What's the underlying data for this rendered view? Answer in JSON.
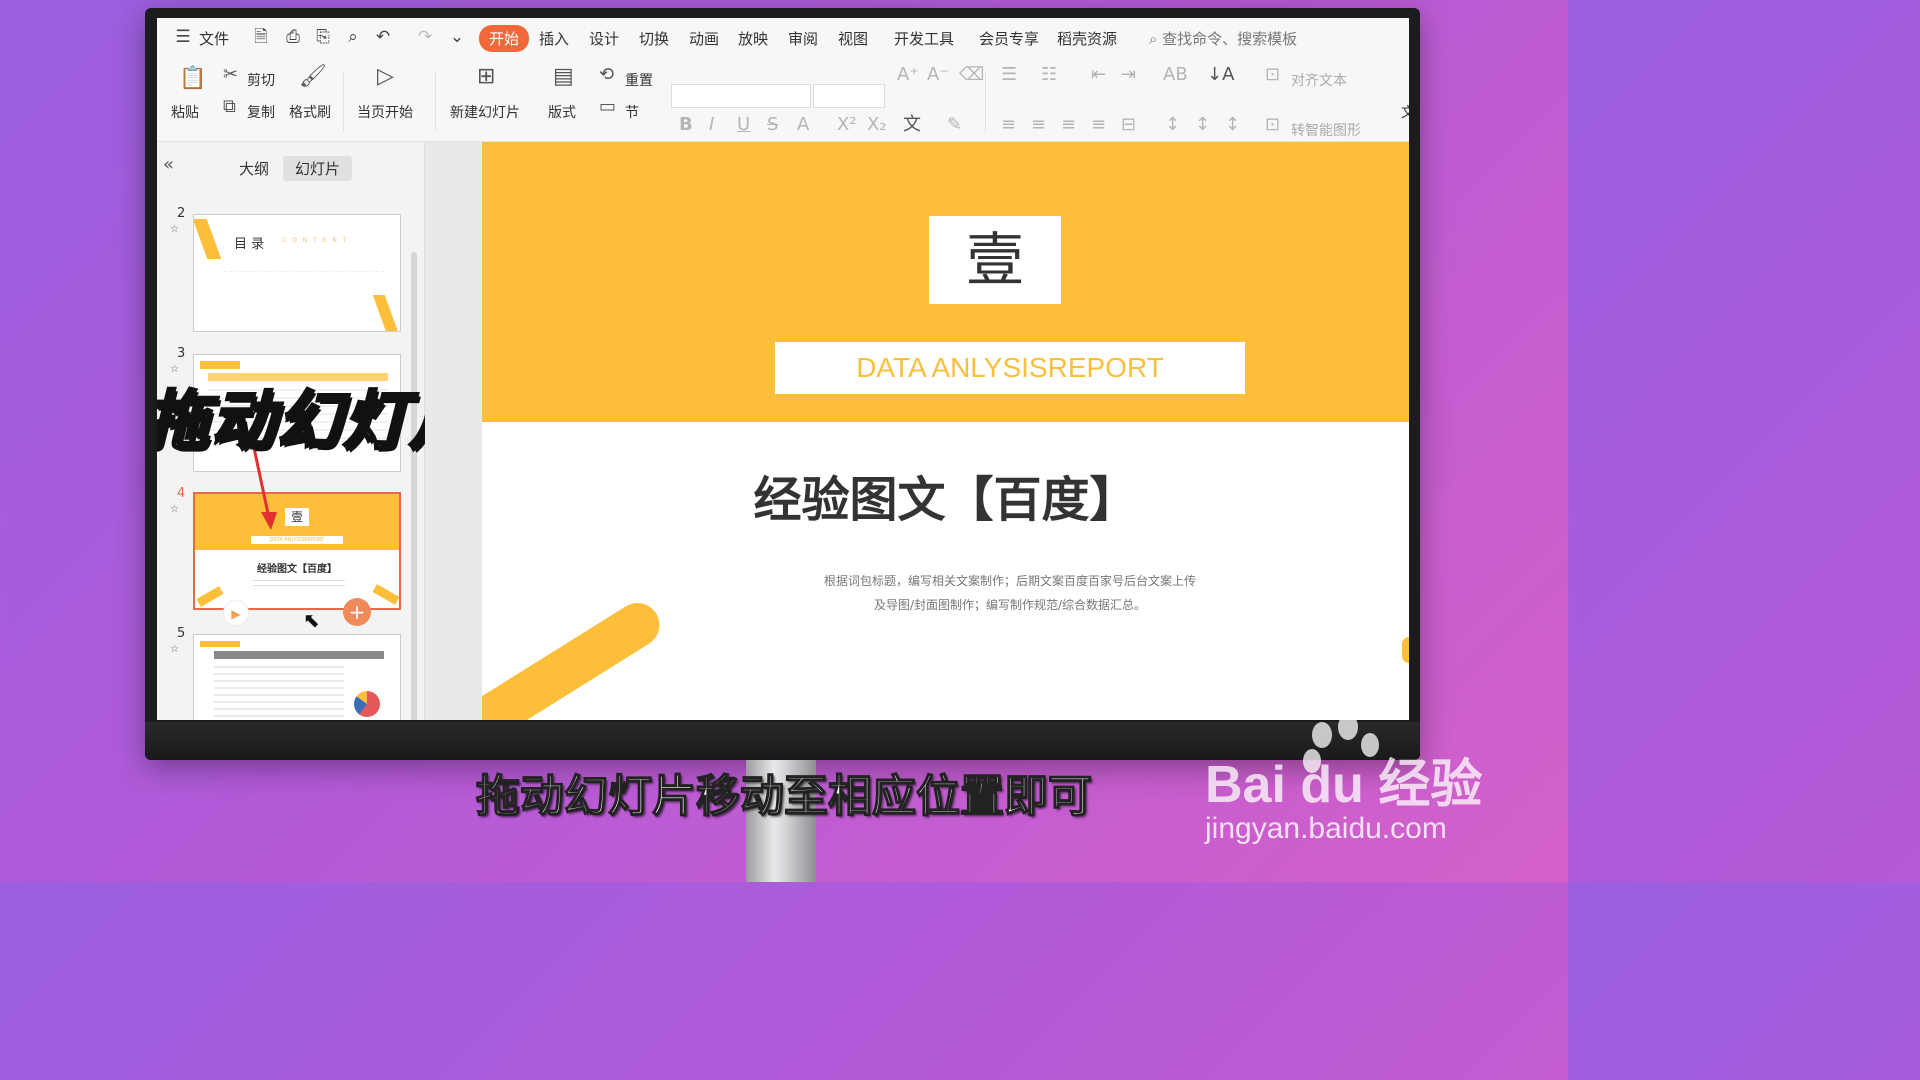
{
  "menubar": {
    "file_label": "文件",
    "tabs": [
      "开始",
      "插入",
      "设计",
      "切换",
      "动画",
      "放映",
      "审阅",
      "视图",
      "开发工具",
      "会员专享",
      "稻壳资源"
    ],
    "active_tab": "开始",
    "search_placeholder": "查找命令、搜索模板",
    "accent_color": "#f3683a"
  },
  "ribbon": {
    "paste": "粘贴",
    "cut": "剪切",
    "copy": "复制",
    "format_painter": "格式刷",
    "start_from_current": "当页开始",
    "new_slide": "新建幻灯片",
    "layout": "版式",
    "reset": "重置",
    "section": "节",
    "align_text": "对齐文本",
    "smart_shape": "转智能图形",
    "text_dir": "文"
  },
  "leftpanel": {
    "tab_outline": "大纲",
    "tab_slides": "幻灯片",
    "active_tab": "幻灯片",
    "slides": [
      {
        "num": "2",
        "title": "目 录",
        "subtitle": "C O N T E N T"
      },
      {
        "num": "3"
      },
      {
        "num": "4",
        "selected": true,
        "badge": "壹",
        "sub": "DATA ANLYSISREPORT",
        "title": "经验图文【百度】"
      },
      {
        "num": "5"
      }
    ],
    "drag_overlay": "拖动幻灯片"
  },
  "slide": {
    "number_char": "壹",
    "subtitle": "DATA ANLYSISREPORT",
    "title": "经验图文【百度】",
    "desc_line1": "根据词包标题，编写相关文案制作；后期文案百度百家号后台文案上传",
    "desc_line2": "及导图/封面图制作；编写制作规范/综合数据汇总。",
    "band_color": "#fdbf3a"
  },
  "caption": "拖动幻灯片移动至相应位置即可",
  "watermark": {
    "brand": "Bai du 经验",
    "url": "jingyan.baidu.com"
  }
}
